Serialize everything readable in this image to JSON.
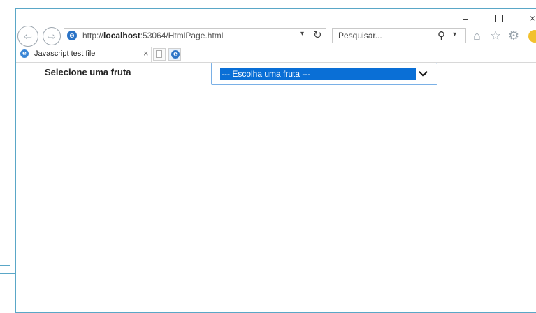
{
  "browser": {
    "window_controls": {
      "minimize": "–",
      "close": "×"
    },
    "nav": {
      "back": "⇦",
      "forward": "⇨"
    },
    "address": {
      "url_prefix": "http://",
      "url_host": "localhost",
      "url_rest": ":53064/HtmlPage.html",
      "dropdown_glyph": "▾",
      "refresh_glyph": "↻"
    },
    "search": {
      "placeholder": "Pesquisar...",
      "icon_glyph": "⚲",
      "dropdown_glyph": "▾"
    },
    "toolbar_icons": {
      "home": "⌂",
      "favorites": "☆",
      "settings": "⚙"
    },
    "tab": {
      "title": "Javascript test file",
      "close": "×"
    },
    "ie_logo_letter": "e"
  },
  "page": {
    "label": "Selecione uma fruta",
    "select": {
      "selected": "--- Escolha uma fruta ---"
    }
  },
  "colors": {
    "accent": "#0a6fd6",
    "window_border": "#5aa7c7",
    "select_border": "#7ab0e6"
  }
}
